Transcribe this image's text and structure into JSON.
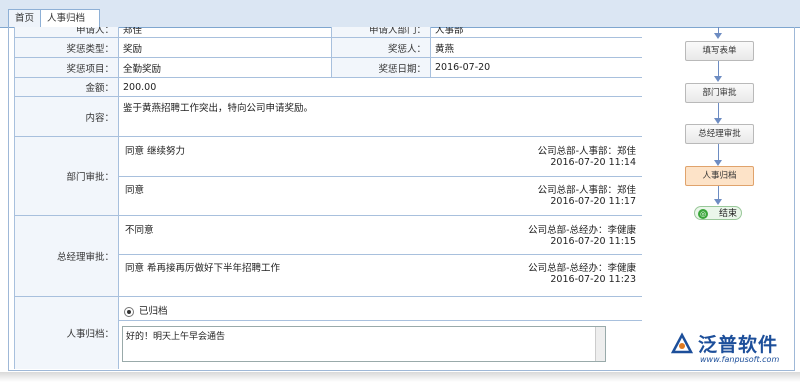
{
  "tabs": [
    {
      "label": "首页"
    },
    {
      "label": "人事归档",
      "close": "✕"
    }
  ],
  "form": {
    "rows": {
      "applicant_label": "申请人：",
      "applicant_value": "郑佳",
      "dept_label": "申请人部门：",
      "dept_value": "人事部",
      "type_label": "奖惩类型：",
      "type_value": "奖励",
      "person_label": "奖惩人：",
      "person_value": "黄燕",
      "item_label": "奖惩项目：",
      "item_value": "全勤奖励",
      "date_label": "奖惩日期：",
      "date_value": "2016-07-20",
      "amount_label": "金额：",
      "amount_value": "200.00",
      "content_label": "内容：",
      "content_value": "鉴于黄燕招聘工作突出，特向公司申请奖励。"
    },
    "dept_approval": {
      "label": "部门审批：",
      "opinions": [
        {
          "text": "同意   继续努力",
          "who": "公司总部-人事部：郑佳",
          "time": "2016-07-20 11:14"
        },
        {
          "text": "同意",
          "who": "公司总部-人事部：郑佳",
          "time": "2016-07-20 11:17"
        }
      ]
    },
    "gm_approval": {
      "label": "总经理审批：",
      "opinions": [
        {
          "text": "不同意",
          "who": "公司总部-总经办：李健康",
          "time": "2016-07-20 11:15"
        },
        {
          "text": "同意   希再接再厉做好下半年招聘工作",
          "who": "公司总部-总经办：李健康",
          "time": "2016-07-20 11:23"
        }
      ]
    },
    "archive": {
      "label": "人事归档：",
      "radio_label": "已归档",
      "comment": "好的！明天上午早会通告"
    }
  },
  "flow": {
    "nodes": [
      "填写表单",
      "部门审批",
      "总经理审批",
      "人事归档"
    ],
    "active": "人事归档",
    "end_label": "结束",
    "end_icon": "◎"
  },
  "logo": {
    "name": "泛普软件",
    "url": "www.fanpusoft.com"
  }
}
